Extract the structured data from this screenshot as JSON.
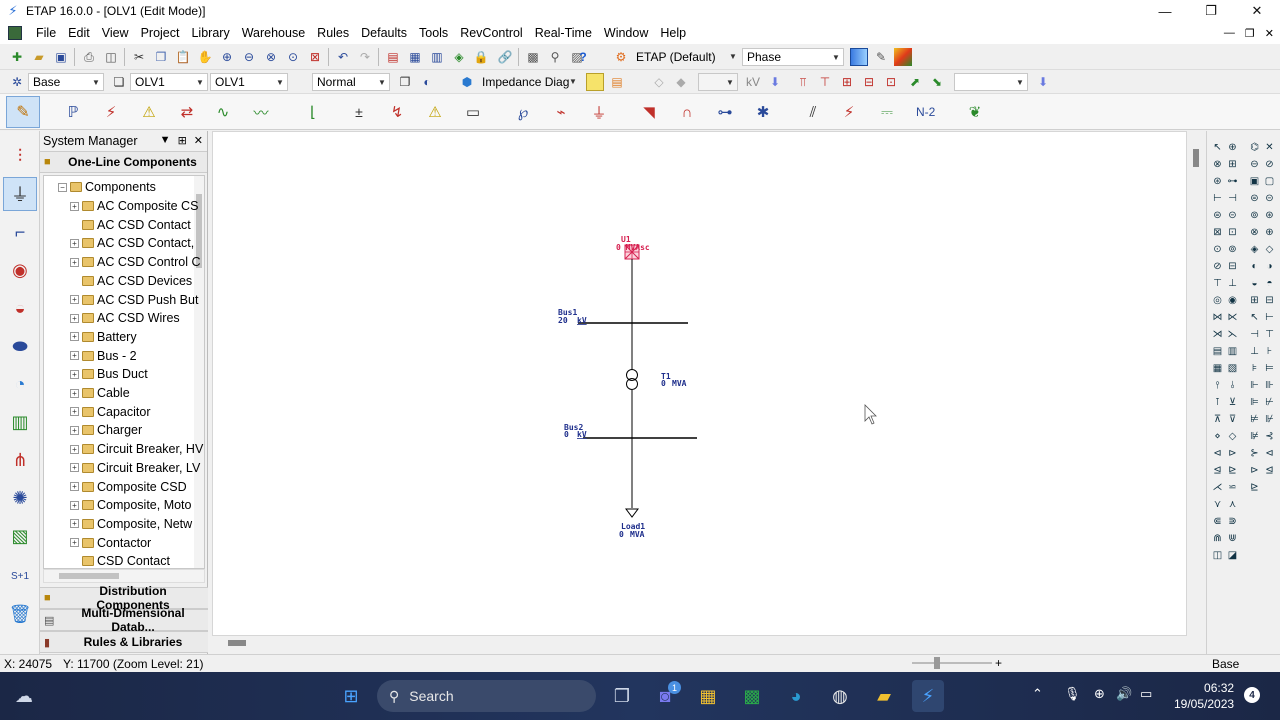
{
  "window": {
    "title": "ETAP 16.0.0 - [OLV1 (Edit Mode)]",
    "controls": [
      "—",
      "❐",
      "✕"
    ],
    "mdi_controls": [
      "—",
      "❐",
      "✕"
    ]
  },
  "menu": [
    "File",
    "Edit",
    "View",
    "Project",
    "Library",
    "Warehouse",
    "Rules",
    "Defaults",
    "Tools",
    "RevControl",
    "Real-Time",
    "Window",
    "Help"
  ],
  "toolbar1": {
    "config_label": "ETAP (Default)",
    "phase_label": "Phase"
  },
  "toolbar2": {
    "base_value": "Base",
    "presentation_value": "OLV1",
    "revision_value": "OLV1",
    "mode_value": "Normal",
    "impedance_label": "Impedance Diag",
    "kv_label": "kV"
  },
  "toolbar3": {
    "n2_label": "N-2"
  },
  "system_manager": {
    "title": "System Manager",
    "header_controls": [
      "▼",
      "⊞",
      "✕"
    ],
    "top_section": "One-Line Components",
    "root_label": "Components",
    "items": [
      {
        "label": "AC Composite CS",
        "expandable": true
      },
      {
        "label": "AC CSD Contact",
        "expandable": false
      },
      {
        "label": "AC CSD Contact,",
        "expandable": true
      },
      {
        "label": "AC CSD Control C",
        "expandable": true
      },
      {
        "label": "AC CSD Devices",
        "expandable": false
      },
      {
        "label": "AC CSD Push But",
        "expandable": true
      },
      {
        "label": "AC CSD Wires",
        "expandable": true
      },
      {
        "label": "Battery",
        "expandable": true
      },
      {
        "label": "Bus - 2",
        "expandable": true
      },
      {
        "label": "Bus Duct",
        "expandable": true
      },
      {
        "label": "Cable",
        "expandable": true
      },
      {
        "label": "Capacitor",
        "expandable": true
      },
      {
        "label": "Charger",
        "expandable": true
      },
      {
        "label": "Circuit Breaker, HV",
        "expandable": true
      },
      {
        "label": "Circuit Breaker, LV",
        "expandable": true
      },
      {
        "label": "Composite CSD",
        "expandable": true
      },
      {
        "label": "Composite, Moto",
        "expandable": true
      },
      {
        "label": "Composite, Netw",
        "expandable": true
      },
      {
        "label": "Contactor",
        "expandable": true
      },
      {
        "label": "CSD Contact",
        "expandable": false
      }
    ],
    "bottom_sections": [
      "Distribution Components",
      "Multi-Dimensional Datab...",
      "Rules & Libraries"
    ]
  },
  "diagram": {
    "source": {
      "name": "U1",
      "value": "0 MVAsc"
    },
    "bus1": {
      "name": "Bus1",
      "value": "20",
      "unit": "kV"
    },
    "transformer": {
      "name": "T1",
      "value": "0",
      "unit": "MVA"
    },
    "bus2": {
      "name": "Bus2",
      "value": "0",
      "unit": "kV"
    },
    "load": {
      "name": "Load1",
      "value": "0",
      "unit": "MVA"
    },
    "colors": {
      "line": "#000000",
      "label": "#1f2f8c",
      "source": "#d62050"
    }
  },
  "statusbar": {
    "x": "X: 24075",
    "y": "Y: 11700 (Zoom Level: 21)",
    "zoom_plus": "+",
    "mode": "Base"
  },
  "taskbar": {
    "search_placeholder": "Search",
    "time": "06:32",
    "date": "19/05/2023",
    "notification_count": "4",
    "chat_badge": "1"
  }
}
